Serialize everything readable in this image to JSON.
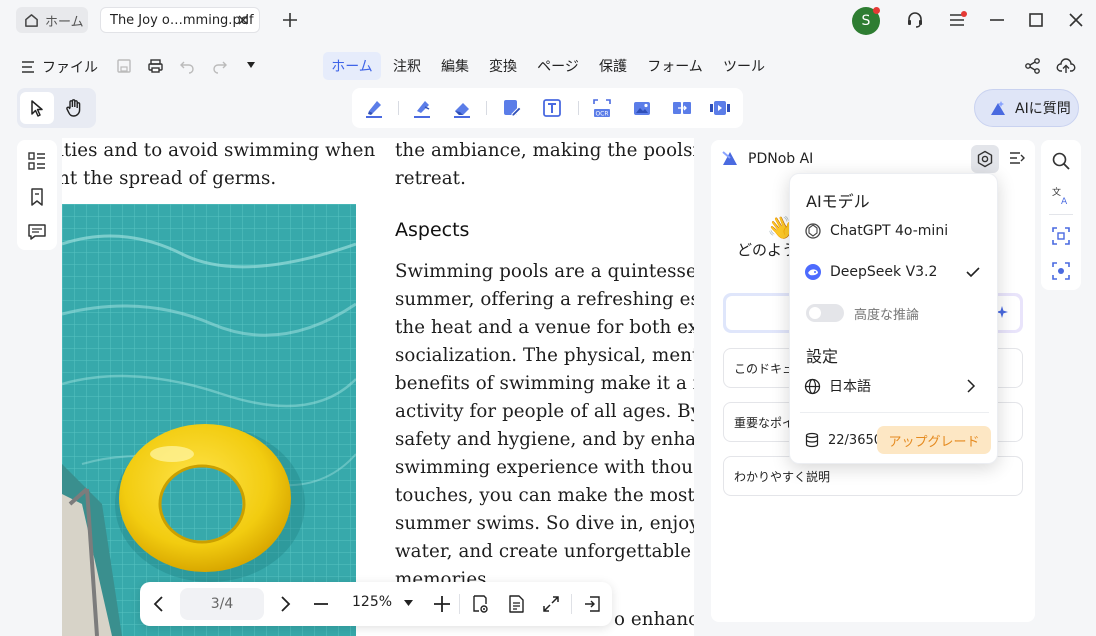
{
  "tabs": {
    "home_label": "ホーム",
    "file_label": "The Joy o…mming.pdf"
  },
  "window": {
    "avatar_letter": "S"
  },
  "menubar": {
    "file_label": "ファイル",
    "items": [
      {
        "label": "ホーム",
        "active": true
      },
      {
        "label": "注釈"
      },
      {
        "label": "編集"
      },
      {
        "label": "変換"
      },
      {
        "label": "ページ"
      },
      {
        "label": "保護"
      },
      {
        "label": "フォーム"
      },
      {
        "label": "ツール"
      }
    ]
  },
  "ask_ai_button": "AIに質問",
  "document": {
    "left_column": [
      "ities and to avoid swimming when",
      "nt the spread of germs."
    ],
    "right_top": [
      "the ambiance, making the poolside",
      "retreat."
    ],
    "heading": "Aspects",
    "paragraph": [
      "Swimming pools are a quintessenti",
      "summer, offering a refreshing escap",
      "the heat and a venue for both exerc",
      "socialization. The physical, mental,",
      "benefits of swimming make it a favo",
      "activity for people of all ages. By pr",
      "safety and hygiene, and by enhancin",
      "swimming experience with thought",
      "touches, you can make the most out",
      "summer swims. So dive in, enjoy th",
      "water, and create unforgettable sun",
      "memories."
    ],
    "bottom_fragment": "o enhance"
  },
  "ai_panel": {
    "title": "PDNob AI",
    "greeting": "どのようにお手伝いできますか?",
    "suggestions": [
      "このドキュメントを要約",
      "重要なポイント",
      "わかりやすく説明"
    ]
  },
  "popup": {
    "models_heading": "AIモデル",
    "models": [
      {
        "name": "ChatGPT 4o-mini",
        "selected": false
      },
      {
        "name": "DeepSeek V3.2",
        "selected": true
      }
    ],
    "advanced_reasoning_label": "高度な推論",
    "advanced_reasoning_on": false,
    "settings_heading": "設定",
    "language": "日本語",
    "credits": "22/3650",
    "upgrade_label": "アップグレード"
  },
  "bottom_nav": {
    "page": "3/4",
    "zoom": "125%"
  },
  "colors": {
    "accent": "#3f64e8",
    "pool_water": "#3fb1b3",
    "pool_ring": "#f4d31a",
    "upgrade_bg": "#fde7c4",
    "upgrade_text": "#e58a1f"
  }
}
